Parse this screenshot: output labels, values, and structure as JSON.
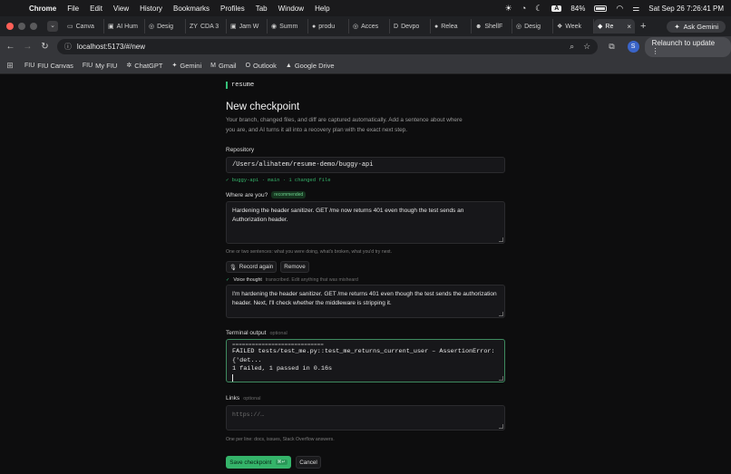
{
  "menubar": {
    "items": [
      "Chrome",
      "File",
      "Edit",
      "View",
      "History",
      "Bookmarks",
      "Profiles",
      "Tab",
      "Window",
      "Help"
    ],
    "battery": "84%",
    "input_badge": "A",
    "clock": "Sat Sep 26  7:26:41 PM"
  },
  "tabs": [
    {
      "icon": "▭",
      "label": "Canva"
    },
    {
      "icon": "▣",
      "label": "AI Hum"
    },
    {
      "icon": "◎",
      "label": "Desig"
    },
    {
      "icon": "ZY",
      "label": "CDA 3"
    },
    {
      "icon": "▣",
      "label": "Jam W"
    },
    {
      "icon": "◉",
      "label": "Summ"
    },
    {
      "icon": "●",
      "label": "produ"
    },
    {
      "icon": "◎",
      "label": "Acces"
    },
    {
      "icon": "D",
      "label": "Devpo"
    },
    {
      "icon": "●",
      "label": "Relea"
    },
    {
      "icon": "☻",
      "label": "ShellF"
    },
    {
      "icon": "◎",
      "label": "Desig"
    },
    {
      "icon": "❖",
      "label": "Week"
    },
    {
      "icon": "◆",
      "label": "Re"
    }
  ],
  "ask_gemini": "Ask Gemini",
  "address": {
    "url": "localhost:5173/#/new",
    "avatar_letter": "S",
    "relaunch": "Relaunch to update"
  },
  "bookmarks": [
    {
      "icon": "FIU",
      "label": "FIU Canvas"
    },
    {
      "icon": "FIU",
      "label": "My FIU"
    },
    {
      "icon": "✲",
      "label": "ChatGPT"
    },
    {
      "icon": "✦",
      "label": "Gemini"
    },
    {
      "icon": "M",
      "label": "Gmail"
    },
    {
      "icon": "O",
      "label": "Outlook"
    },
    {
      "icon": "▲",
      "label": "Google Drive"
    }
  ],
  "page": {
    "brand": "resume",
    "title": "New checkpoint",
    "intro": "Your branch, changed files, and diff are captured automatically. Add a sentence about where you are, and AI turns it all into a recovery plan with the exact next step.",
    "repo_label": "Repository",
    "repo_path": "/Users/alihatem/resume-demo/buggy-api",
    "repo_status": "✓ buggy-api · main · 1 changed file",
    "where_label": "Where are you?",
    "where_badge": "recommended",
    "where_value": "Hardening the header sanitizer. GET /me now returns 401 even though the test sends an Authorization header.",
    "where_hint": "One or two sentences: what you were doing, what's broken, what you'd try next.",
    "record_again": "Record again",
    "remove": "Remove",
    "voice_title": "Voice thought",
    "voice_sub": "transcribed. Edit anything that was misheard",
    "voice_value": "I'm hardening the header sanitizer. GET /me returns 401 even though the test sends the authorization header. Next, I'll check whether the middleware is stripping it.",
    "terminal_label": "Terminal output",
    "terminal_optional": "optional",
    "terminal_cut": "============================",
    "terminal_line1": "FAILED tests/test_me.py::test_me_returns_current_user – AssertionError:",
    "terminal_line2": "{'det...",
    "terminal_line3": "1 failed, 1 passed in 0.16s",
    "links_label": "Links",
    "links_optional": "optional",
    "links_placeholder": "https://…",
    "links_hint": "One per line: docs, issues, Stack Overflow answers.",
    "save": "Save checkpoint",
    "save_kbd": "⌘↵",
    "cancel": "Cancel"
  },
  "colors": {
    "accent": "#35b46a",
    "background": "#0d0d0e",
    "field": "#17171a"
  }
}
